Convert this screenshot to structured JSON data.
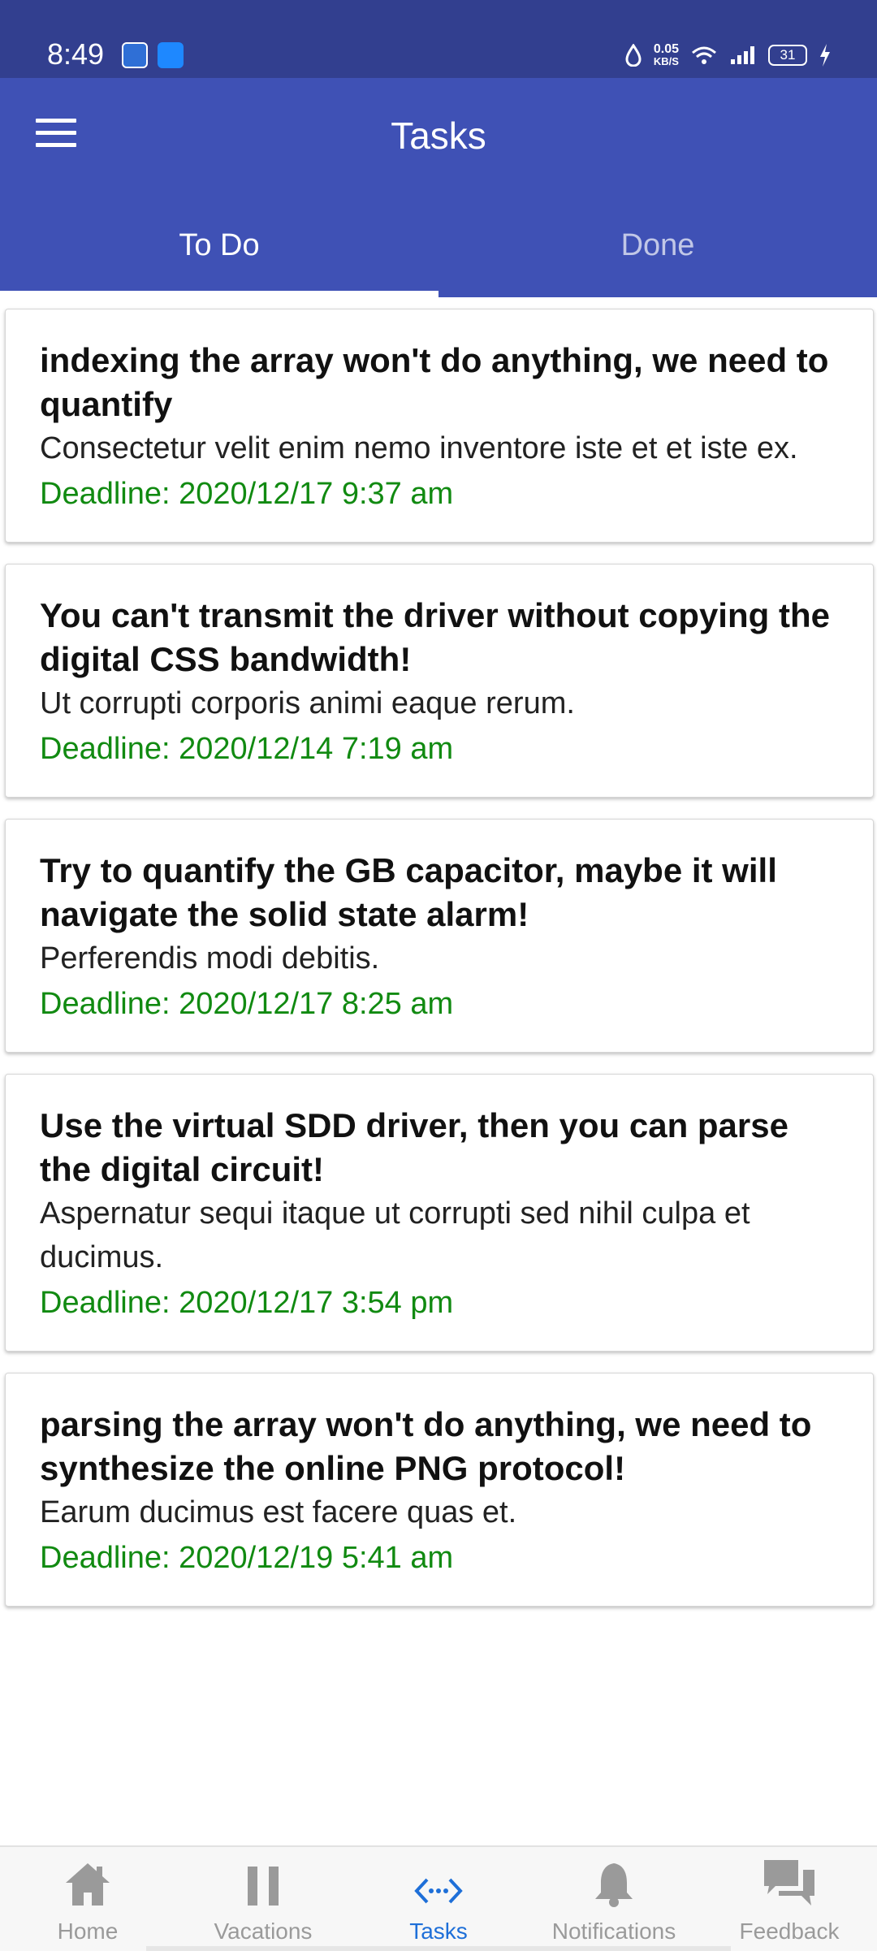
{
  "status_bar": {
    "time": "8:49",
    "net_speed_value": "0.05",
    "net_speed_unit": "KB/S",
    "battery": "31"
  },
  "app_bar": {
    "title": "Tasks"
  },
  "tabs": [
    {
      "label": "To Do",
      "active": true
    },
    {
      "label": "Done",
      "active": false
    }
  ],
  "tasks": [
    {
      "title": "indexing the array won't do anything, we need to quantify",
      "description": "Consectetur velit enim nemo inventore iste et et iste ex.",
      "deadline": "Deadline: 2020/12/17 9:37 am"
    },
    {
      "title": "You can't transmit the driver without copying the digital CSS bandwidth!",
      "description": "Ut corrupti corporis animi eaque rerum.",
      "deadline": "Deadline: 2020/12/14 7:19 am"
    },
    {
      "title": "Try to quantify the GB capacitor, maybe it will navigate the solid state alarm!",
      "description": "Perferendis modi debitis.",
      "deadline": "Deadline: 2020/12/17 8:25 am"
    },
    {
      "title": "Use the virtual SDD driver, then you can parse the digital circuit!",
      "description": "Aspernatur sequi itaque ut corrupti sed nihil culpa et ducimus.",
      "deadline": "Deadline: 2020/12/17 3:54 pm"
    },
    {
      "title": "parsing the array won't do anything, we need to synthesize the online PNG protocol!",
      "description": "Earum ducimus est facere quas et.",
      "deadline": "Deadline: 2020/12/19 5:41 am"
    }
  ],
  "bottom_nav": [
    {
      "label": "Home",
      "icon": "home-icon",
      "active": false
    },
    {
      "label": "Vacations",
      "icon": "pause-icon",
      "active": false
    },
    {
      "label": "Tasks",
      "icon": "code-icon",
      "active": true
    },
    {
      "label": "Notifications",
      "icon": "bell-icon",
      "active": false
    },
    {
      "label": "Feedback",
      "icon": "chat-icon",
      "active": false
    }
  ],
  "colors": {
    "primary": "#3f51b5",
    "status_bar": "#323f8f",
    "deadline": "#118a11",
    "nav_active": "#1e6fd8",
    "nav_inactive": "#9a9a9a"
  }
}
